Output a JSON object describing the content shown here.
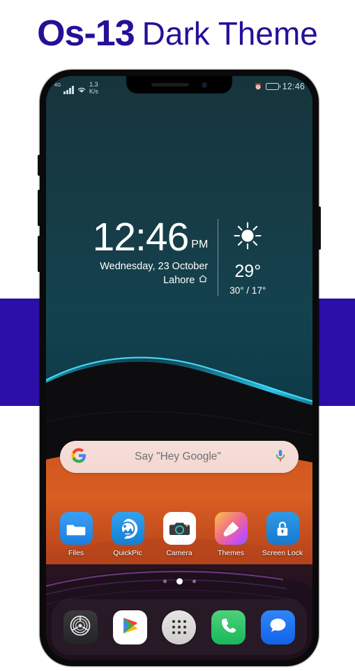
{
  "title": {
    "strong": "Os-13",
    "light": "Dark Theme",
    "color": "#241099"
  },
  "accent_band_color": "#2b0fa8",
  "phone": {
    "status_bar": {
      "network_type": "4G",
      "signal_icon": "signal-bars-icon",
      "wifi_icon": "wifi-icon",
      "data_speed_value": "1.3",
      "data_speed_unit": "K/s",
      "alarm_icon": "alarm-icon",
      "battery_icon": "battery-icon",
      "time": "12:46"
    },
    "widget": {
      "time": "12:46",
      "ampm": "PM",
      "date": "Wednesday, 23 October",
      "city": "Lahore",
      "home_icon": "home-icon",
      "weather_icon": "sun-icon",
      "temperature": "29°",
      "temperature_range": "30° / 17°"
    },
    "search": {
      "google_icon": "google-g-icon",
      "placeholder": "Say \"Hey Google\"",
      "mic_icon": "microphone-icon"
    },
    "apps": [
      {
        "label": "Files",
        "icon": "folder-icon"
      },
      {
        "label": "QuickPic",
        "icon": "photo-gallery-icon"
      },
      {
        "label": "Camera",
        "icon": "camera-icon"
      },
      {
        "label": "Themes",
        "icon": "paint-brush-icon"
      },
      {
        "label": "Screen Lock",
        "icon": "padlock-icon"
      }
    ],
    "page_indicator": {
      "count": 3,
      "active_index": 1
    },
    "dock": [
      {
        "name": "settings",
        "icon": "gear-icon"
      },
      {
        "name": "play-store",
        "icon": "play-store-icon"
      },
      {
        "name": "app-drawer",
        "icon": "app-drawer-icon"
      },
      {
        "name": "phone",
        "icon": "phone-handset-icon"
      },
      {
        "name": "messages",
        "icon": "message-bubble-icon"
      }
    ]
  }
}
